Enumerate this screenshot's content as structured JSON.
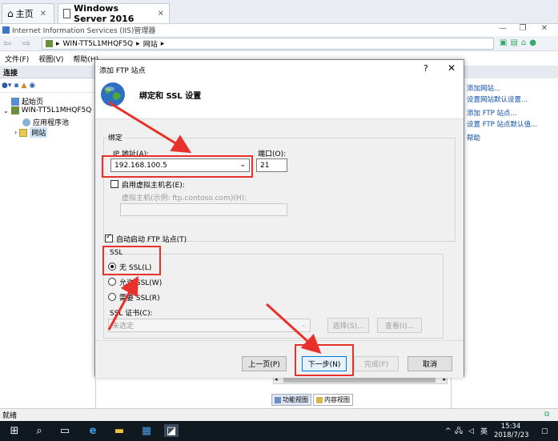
{
  "vm_tabs": [
    {
      "label": "主页",
      "icon": "home-icon"
    },
    {
      "label": "Windows Server 2016",
      "icon": "server-icon"
    }
  ],
  "iis": {
    "title": "Internet Information Services (IIS)管理器",
    "breadcrumb": [
      "WIN-TT5L1MHQF5Q",
      "网站"
    ],
    "menu": [
      "文件(F)",
      "视图(V)",
      "帮助(H)"
    ]
  },
  "connections": {
    "header": "连接",
    "tree": [
      "起始页",
      "WIN-TT5L1MHQF5Q (W",
      "应用程序池",
      "网站"
    ]
  },
  "actions": {
    "header": "作",
    "items": [
      "添加网站...",
      "设置网站默认设置...",
      "添加 FTP 站点...",
      "设置 FTP 站点默认值...",
      "帮助"
    ]
  },
  "view_tabs": [
    "功能视图",
    "内容视图"
  ],
  "status": "就绪",
  "clock": {
    "time": "15:34",
    "date": "2018/7/23"
  },
  "tray": {
    "lang": "英"
  },
  "dialog": {
    "title": "添加 FTP 站点",
    "help": "?",
    "close": "✕",
    "heading": "绑定和 SSL 设置",
    "binding": {
      "group_label": "绑定",
      "ip_label": "IP 地址(A):",
      "ip_value": "192.168.100.5",
      "port_label": "端口(O):",
      "port_value": "21",
      "vhost_label": "启用虚拟主机名(E):",
      "vhost_hint": "虚拟主机(示例: ftp.contoso.com)(H):"
    },
    "autostart_label": "自动启动 FTP 站点(T)",
    "ssl": {
      "group_label": "SSL",
      "options": [
        "无 SSL(L)",
        "允许 SSL(W)",
        "需要 SSL(R)"
      ],
      "cert_label": "SSL 证书(C):",
      "cert_value": "未选定",
      "select_btn": "选择(S)...",
      "view_btn": "查看(I)..."
    },
    "buttons": {
      "prev": "上一页(P)",
      "next": "下一步(N)",
      "finish": "完成(F)",
      "cancel": "取消"
    }
  }
}
